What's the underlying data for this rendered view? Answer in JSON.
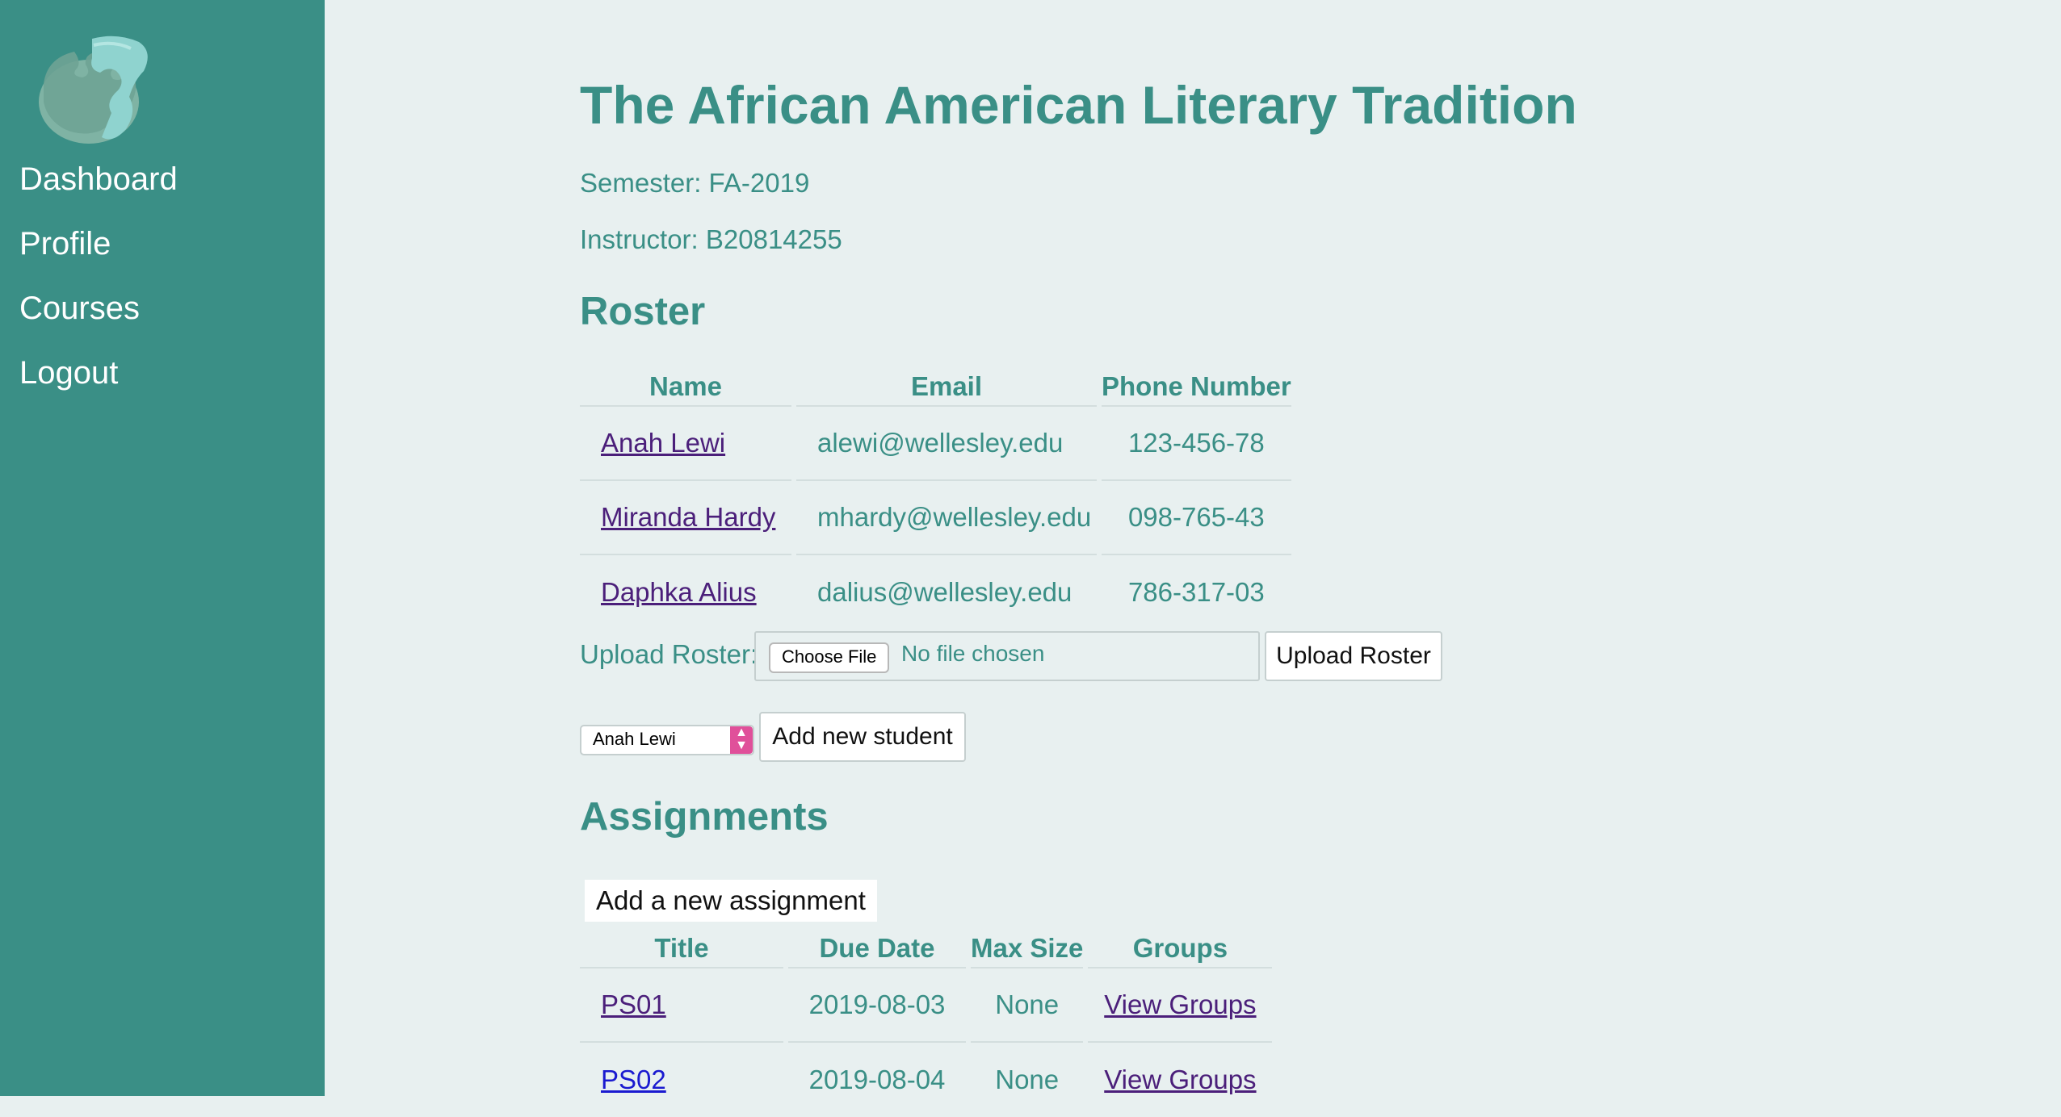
{
  "sidebar": {
    "logo_icon": "puzzle-piece-logo",
    "items": [
      {
        "label": "Dashboard"
      },
      {
        "label": "Profile"
      },
      {
        "label": "Courses"
      },
      {
        "label": "Logout"
      }
    ]
  },
  "course": {
    "title": "The African American Literary Tradition",
    "semester": "Semester: FA-2019",
    "instructor": "Instructor: B20814255"
  },
  "roster": {
    "heading": "Roster",
    "columns": [
      "Name",
      "Email",
      "Phone Number"
    ],
    "rows": [
      {
        "name": "Anah Lewi",
        "email": "alewi@wellesley.edu",
        "phone": "123-456-78"
      },
      {
        "name": "Miranda Hardy",
        "email": "mhardy@wellesley.edu",
        "phone": "098-765-43"
      },
      {
        "name": "Daphka Alius",
        "email": "dalius@wellesley.edu",
        "phone": "786-317-03"
      }
    ],
    "upload_label": "Upload Roster:",
    "choose_file": "Choose File",
    "no_file": "No file chosen",
    "upload_button": "Upload Roster",
    "student_select_value": "Anah Lewi",
    "add_student_button": "Add new student"
  },
  "assignments": {
    "heading": "Assignments",
    "add_button": "Add a new assignment",
    "columns": [
      "Title",
      "Due Date",
      "Max Size",
      "Groups"
    ],
    "rows": [
      {
        "title": "PS01",
        "due": "2019-08-03",
        "max": "None",
        "groups": "View Groups"
      },
      {
        "title": "PS02",
        "due": "2019-08-04",
        "max": "None",
        "groups": "View Groups"
      }
    ]
  },
  "colors": {
    "sidebar_bg": "#3a8f86",
    "page_bg": "#e8f0f0",
    "accent_text": "#3a8f86",
    "link": "#4b1f7a",
    "select_arrow": "#e0509a"
  }
}
